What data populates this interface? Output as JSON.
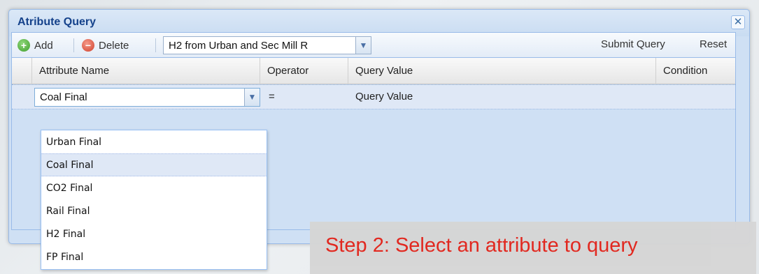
{
  "window": {
    "title": "Atribute Query",
    "close_glyph": "✕"
  },
  "toolbar": {
    "add_label": "Add",
    "add_icon": "add-icon",
    "delete_label": "Delete",
    "delete_icon": "delete-icon",
    "query_select_value": "H2 from Urban and Sec Mill R",
    "submit_label": "Submit Query",
    "reset_label": "Reset"
  },
  "grid": {
    "columns": [
      "Attribute Name",
      "Operator",
      "Query Value",
      "Condition"
    ],
    "rows": [
      {
        "attribute": "Coal Final",
        "operator": "=",
        "query_value": "Query Value",
        "condition": ""
      }
    ]
  },
  "dropdown": {
    "options": [
      "Urban Final",
      "Coal Final",
      "CO2 Final",
      "Rail Final",
      "H2 Final",
      "FP Final"
    ],
    "selected": "Coal Final"
  },
  "annotation": {
    "text": "Step 2: Select an attribute to query",
    "color": "#e2231a"
  },
  "colors": {
    "title": "#15428b",
    "border": "#99bbe8",
    "selection": "#dfe8f6"
  }
}
